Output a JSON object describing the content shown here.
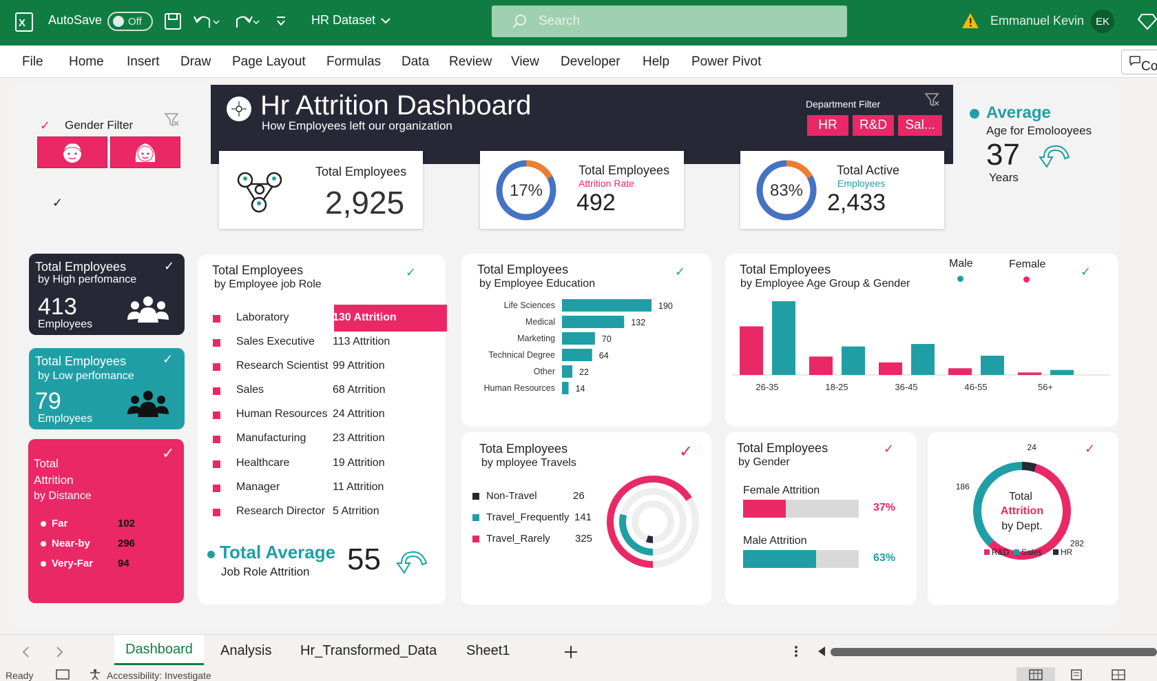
{
  "app": {
    "autosave_label": "AutoSave",
    "autosave_state": "Off",
    "doc_title": "HR Dataset",
    "search_placeholder": "Search",
    "user_name": "Emmanuel Kevin",
    "user_initials": "EK",
    "comments_label": "Co"
  },
  "menu": [
    "File",
    "Home",
    "Insert",
    "Draw",
    "Page Layout",
    "Formulas",
    "Data",
    "Review",
    "View",
    "Developer",
    "Help",
    "Power Pivot"
  ],
  "gender_filter": {
    "label": "Gender Filter"
  },
  "header": {
    "title": "Hr Attrition Dashboard",
    "subtitle": "How Employees left our organization",
    "dept_filter_label": "Department Filter",
    "dept_buttons": [
      "HR",
      "R&D",
      "Sal..."
    ]
  },
  "kpi": {
    "total": {
      "label": "Total Employees",
      "value": "2,925"
    },
    "attrition": {
      "label": "Total Employees",
      "sub": "Attrition Rate",
      "value": "492",
      "pct_label": "17%",
      "pct": 17
    },
    "active": {
      "label": "Total Active",
      "sub": "Employees",
      "value": "2,433",
      "pct_label": "83%",
      "pct": 83
    },
    "avg_age": {
      "title": "Average",
      "label": "Age for Emolooyees",
      "value": "37",
      "unit": "Years"
    }
  },
  "high_perf": {
    "title": "Total Employees",
    "sub": "by High perfomance",
    "value": "413",
    "unit": "Employees"
  },
  "low_perf": {
    "title": "Total Employees",
    "sub": "by Low perfomance",
    "value": "79",
    "unit": "Employees"
  },
  "distance": {
    "title1": "Total",
    "title2": "Attrition",
    "sub": "by Distance",
    "rows": [
      {
        "name": "Far",
        "value": "102"
      },
      {
        "name": "Near-by",
        "value": "296"
      },
      {
        "name": "Very-Far",
        "value": "94"
      }
    ]
  },
  "job_role": {
    "title": "Total Employees",
    "sub": "by Employee job Role",
    "rows": [
      {
        "name": "Laboratory",
        "value": "130 Attrition"
      },
      {
        "name": "Sales Executive",
        "value": "113 Attrition"
      },
      {
        "name": "Research Scientist",
        "value": "99 Attrition"
      },
      {
        "name": "Sales",
        "value": "68 Atrrition"
      },
      {
        "name": "Human Resources",
        "value": "24 Attrition"
      },
      {
        "name": "Manufacturing",
        "value": "23 Attrition"
      },
      {
        "name": "Healthcare",
        "value": "19 Attrition"
      },
      {
        "name": "Manager",
        "value": "11 Attrition"
      },
      {
        "name": "Research Director",
        "value": "5 Atrrition"
      }
    ],
    "avg_title": "Total Average",
    "avg_sub": "Job Role Attrition",
    "avg_value": "55"
  },
  "education_card": {
    "title": "Total Employees",
    "sub": "by Employee Education"
  },
  "age_card": {
    "title": "Total Employees",
    "sub": "by Employee Age Group & Gender",
    "male_label": "Male",
    "female_label": "Female"
  },
  "travel_card": {
    "title": "Tota Employees",
    "sub": "by mployee Travels",
    "rows": [
      {
        "name": "Non-Travel",
        "value": "26"
      },
      {
        "name": "Travel_Frequently",
        "value": "141"
      },
      {
        "name": "Travel_Rarely",
        "value": "325"
      }
    ]
  },
  "gender_card": {
    "title": "Total Employees",
    "sub": "by Gender",
    "rows": [
      {
        "name": "Female Attrition",
        "value": "37%",
        "pct": 37
      },
      {
        "name": "Male Attrition",
        "value": "63%",
        "pct": 63
      }
    ]
  },
  "dept_card": {
    "center1": "Total",
    "center2": "Attrition",
    "center3": "by Dept."
  },
  "chart_data": [
    {
      "type": "bar",
      "orientation": "horizontal",
      "categories": [
        "Life Sciences",
        "Medical",
        "Marketing",
        "Technical Degree",
        "Other",
        "Human Resources"
      ],
      "values": [
        190,
        132,
        70,
        64,
        22,
        14
      ]
    },
    {
      "type": "bar",
      "categories": [
        "26-35",
        "18-25",
        "36-45",
        "46-55",
        "56+"
      ],
      "series": [
        {
          "name": "Female",
          "values": [
            58,
            22,
            15,
            8,
            3
          ]
        },
        {
          "name": "Male",
          "values": [
            88,
            34,
            37,
            23,
            6
          ]
        }
      ],
      "legend": "top-right"
    },
    {
      "type": "pie",
      "categories": [
        "Non-Travel",
        "Travel_Frequently",
        "Travel_Rarely"
      ],
      "values": [
        26,
        141,
        325
      ]
    },
    {
      "type": "pie",
      "categories": [
        "R&D",
        "Sales",
        "HR"
      ],
      "values": [
        282,
        186,
        24
      ],
      "legend": "bottom"
    }
  ],
  "colors": {
    "green": "#107c41",
    "pink": "#ea2866",
    "teal": "#1f9fa5",
    "dark": "#262836",
    "blue": "#4472c4",
    "orange": "#ed7d31"
  },
  "tabs": [
    "Dashboard",
    "Analysis",
    "Hr_Transformed_Data",
    "Sheet1"
  ],
  "status": {
    "ready": "Ready",
    "accessibility": "Accessibility: Investigate"
  }
}
